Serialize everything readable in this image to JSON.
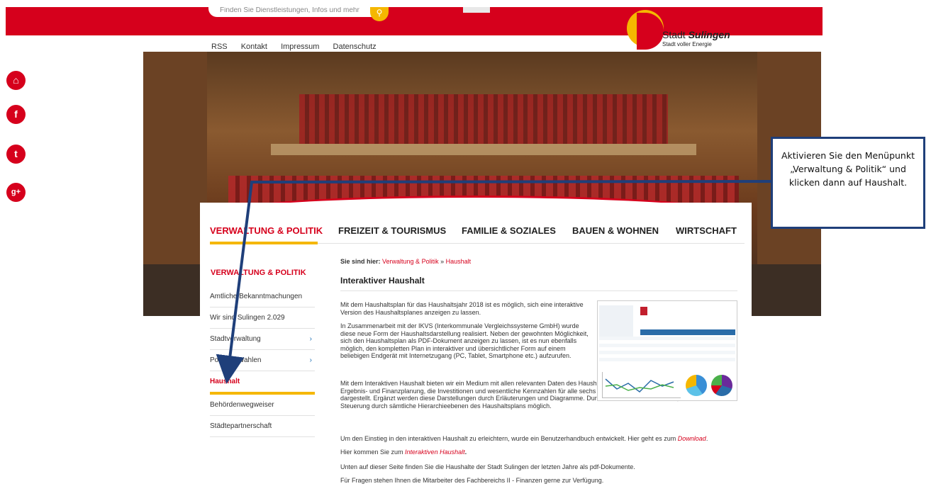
{
  "header": {
    "search_placeholder": "Finden Sie Dienstleistungen, Infos und mehr",
    "search_button_icon": "magnifier-icon",
    "top_links": [
      "RSS",
      "Kontakt",
      "Impressum",
      "Datenschutz"
    ],
    "logo_name_1": "Stadt",
    "logo_name_2": "Sulingen",
    "logo_tagline": "Stadt voller Energie"
  },
  "social": [
    {
      "icon": "home-icon",
      "glyph": "⌂"
    },
    {
      "icon": "facebook-icon",
      "glyph": "f"
    },
    {
      "icon": "twitter-icon",
      "glyph": "t"
    },
    {
      "icon": "googleplus-icon",
      "glyph": "g+"
    }
  ],
  "main_nav": [
    "VERWALTUNG & POLITIK",
    "FREIZEIT & TOURISMUS",
    "FAMILIE & SOZIALES",
    "BAUEN & WOHNEN",
    "WIRTSCHAFT"
  ],
  "sidebar": {
    "title": "VERWALTUNG & POLITIK",
    "items": [
      {
        "label": "Amtliche Bekanntmachungen",
        "chevron": ""
      },
      {
        "label": "Wir sind Sulingen 2.029",
        "chevron": ""
      },
      {
        "label": "Stadtverwaltung",
        "chevron": "›"
      },
      {
        "label": "Politik & Wahlen",
        "chevron": "›"
      },
      {
        "label": "Haushalt",
        "chevron": ""
      },
      {
        "label": "Behördenwegweiser",
        "chevron": ""
      },
      {
        "label": "Städtepartnerschaft",
        "chevron": ""
      }
    ]
  },
  "breadcrumb": {
    "prefix": "Sie sind hier:",
    "level1": "Verwaltung & Politik",
    "sep": "»",
    "level2": "Haushalt"
  },
  "content": {
    "title": "Interaktiver Haushalt",
    "p1": "Mit dem Haushaltsplan für das Haushaltsjahr 2018 ist es möglich, sich eine interaktive Version des Haushaltsplanes anzeigen zu lassen.",
    "p2": "In Zusammenarbeit mit der IKVS (Interkommunale Vergleichssysteme GmbH) wurde diese neue Form der Haushaltsdarstellung realisiert. Neben der gewohnten Möglichkeit, sich den Haushaltsplan als PDF-Dokument anzeigen zu lassen, ist es nun ebenfalls möglich, den kompletten Plan in interaktiver und übersichtlicher Form auf einem beliebigen Endgerät mit Internetzugang (PC, Tablet, Smartphone etc.) aufzurufen.",
    "p3": "Mit dem Interaktiven Haushalt bieten wir ein Medium mit allen relevanten Daten des Haushaltsplans. In übersichtlicher Form werden die Ergebnis- und Finanzplanung, die Investitionen und wesentliche Kennzahlen für alle sechs Jahre des mittelfristigen Planungszeitraums dargestellt. Ergänzt werden diese Darstellungen durch Erläuterungen und Diagramme. Durch Mausklick ist eine flexible, interaktive Steuerung durch sämtliche Hierarchieebenen des Haushaltsplans möglich.",
    "p4_text": "Um den Einstieg in den interaktiven Haushalt zu erleichtern, wurde ein Benutzerhandbuch entwickelt. Hier geht es zum",
    "p4_link": "Download",
    "p5_text": "Hier kommen Sie zum",
    "p5_link": "Interaktiven Haushalt",
    "p6": "Unten auf dieser Seite finden Sie die Haushalte der Stadt Sulingen der letzten Jahre als pdf-Dokumente.",
    "p7": "Für Fragen stehen Ihnen die Mitarbeiter des Fachbereichs II - Finanzen gerne zur Verfügung."
  },
  "callout": {
    "text": "Aktivieren Sie den Menüpunkt „Verwaltung & Politik“ und klicken dann auf Haushalt."
  },
  "colors": {
    "brand_red": "#d6001c",
    "accent_yellow": "#f5b700",
    "callout_border": "#1f3f7a"
  }
}
